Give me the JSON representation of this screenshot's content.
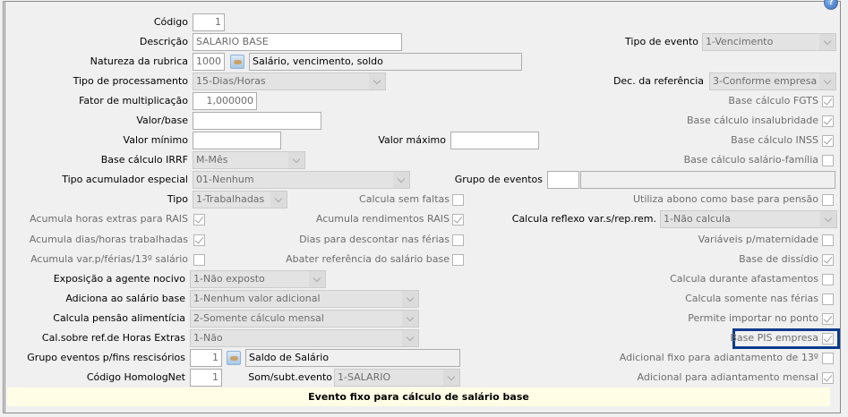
{
  "form": {
    "codigo": {
      "label": "Código",
      "value": "1"
    },
    "descricao": {
      "label": "Descrição",
      "value": "SALARIO BASE"
    },
    "natureza": {
      "label": "Natureza da rubrica",
      "value": "1000",
      "description": "Salário, vencimento, soldo"
    },
    "tipo_processamento": {
      "label": "Tipo de processamento",
      "value": "15-Dias/Horas"
    },
    "fator": {
      "label": "Fator de multiplicação",
      "value": "1,000000"
    },
    "valor_base": {
      "label": "Valor/base",
      "value": ""
    },
    "valor_minimo": {
      "label": "Valor mínimo",
      "value": ""
    },
    "valor_maximo": {
      "label": "Valor máximo",
      "value": ""
    },
    "base_irrf": {
      "label": "Base cálculo IRRF",
      "value": "M-Mês"
    },
    "tipo_acumulador": {
      "label": "Tipo acumulador especial",
      "value": "01-Nenhum"
    },
    "grupo_eventos": {
      "label": "Grupo de eventos",
      "value": "",
      "description": ""
    },
    "tipo": {
      "label": "Tipo",
      "value": "1-Trabalhadas"
    },
    "tipo_evento": {
      "label": "Tipo de evento",
      "value": "1-Vencimento"
    },
    "dec_referencia": {
      "label": "Dec. da referência",
      "value": "3-Conforme empresa"
    },
    "calcula_reflexo": {
      "label": "Calcula reflexo var.s/rep.rem.",
      "value": "1-Não calcula"
    },
    "exposicao": {
      "label": "Exposição a agente nocivo",
      "value": "1-Não exposto"
    },
    "adiciona": {
      "label": "Adiciona ao salário base",
      "value": "1-Nenhum valor adicional"
    },
    "pensao": {
      "label": "Calcula pensão alimentícia",
      "value": "2-Somente cálculo mensal"
    },
    "horas_extras": {
      "label": "Cal.sobre ref.de Horas Extras",
      "value": "1-Não"
    },
    "grupo_rescisorios": {
      "label": "Grupo eventos p/fins rescisórios",
      "value": "1",
      "description": "Saldo de Salário"
    },
    "homolognet": {
      "label": "Código HomologNet",
      "value": "1"
    },
    "som_subt": {
      "label": "Som/subt.evento",
      "value": "1-SALARIO"
    }
  },
  "checkboxes": {
    "left": [
      {
        "label": "Acumula horas extras para RAIS",
        "checked": true
      },
      {
        "label": "Acumula dias/horas trabalhadas",
        "checked": true
      },
      {
        "label": "Acumula var.p/férias/13º salário",
        "checked": false
      }
    ],
    "middle": [
      {
        "label": "Calcula sem faltas",
        "checked": false
      },
      {
        "label": "Acumula rendimentos RAIS",
        "checked": true
      },
      {
        "label": "Dias para descontar nas férias",
        "checked": false
      },
      {
        "label": "Abater referência do salário base",
        "checked": false
      }
    ],
    "right": [
      {
        "label": "Base cálculo FGTS",
        "checked": true
      },
      {
        "label": "Base cálculo insalubridade",
        "checked": true
      },
      {
        "label": "Base cálculo INSS",
        "checked": true
      },
      {
        "label": "Base cálculo salário-família",
        "checked": false
      },
      {
        "label": "Utiliza abono como base para pensão",
        "checked": false
      },
      {
        "label": "Variáveis p/maternidade",
        "checked": false
      },
      {
        "label": "Base de dissídio",
        "checked": true
      },
      {
        "label": "Calcula durante afastamentos",
        "checked": false
      },
      {
        "label": "Calcula somente nas férias",
        "checked": false
      },
      {
        "label": "Permite importar no ponto",
        "checked": true
      },
      {
        "label": "Base PIS empresa",
        "checked": true,
        "highlighted": true
      },
      {
        "label": "Adicional fixo para adiantamento de 13º",
        "checked": false
      },
      {
        "label": "Adicional para adiantamento mensal",
        "checked": true
      }
    ]
  },
  "help_icon": "help-icon",
  "status_bar": {
    "text": "Evento fixo para cálculo de salário base",
    "background": "#fffde6"
  },
  "highlight_color": "#0a3a8c"
}
